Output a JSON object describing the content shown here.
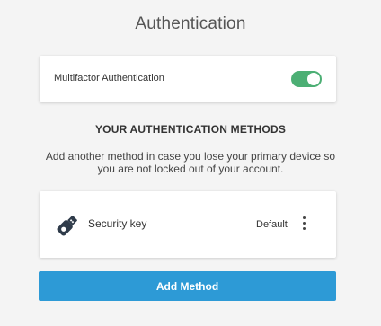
{
  "page": {
    "title": "Authentication"
  },
  "mfa": {
    "label": "Multifactor Authentication",
    "enabled": true
  },
  "methods_section": {
    "heading": "YOUR AUTHENTICATION METHODS",
    "description": "Add another method in case you lose your primary device so you are not locked out of your account."
  },
  "methods": [
    {
      "name": "Security key",
      "status": "Default",
      "icon": "usb-security-key-icon",
      "menu_icon": "more-vertical-icon"
    }
  ],
  "actions": {
    "add_method_label": "Add Method"
  },
  "colors": {
    "toggle_on": "#4caf74",
    "primary_button": "#2d9ad6",
    "background": "#f4f4f4",
    "card": "#ffffff"
  }
}
